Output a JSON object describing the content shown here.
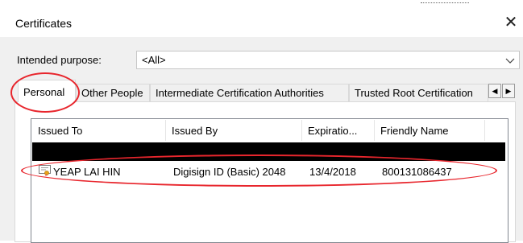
{
  "window": {
    "title": "Certificates",
    "close_glyph": "✕"
  },
  "purpose": {
    "label": "Intended purpose:",
    "value": "<All>",
    "chevron": "chevron-down-icon"
  },
  "tabs": [
    {
      "label": "Personal",
      "active": true
    },
    {
      "label": "Other People",
      "active": false
    },
    {
      "label": "Intermediate Certification Authorities",
      "active": false
    },
    {
      "label": "Trusted Root Certification",
      "active": false
    }
  ],
  "tab_scroll": {
    "left": "◀",
    "right": "▶"
  },
  "columns": [
    "Issued To",
    "Issued By",
    "Expiratio...",
    "Friendly Name"
  ],
  "rows": [
    {
      "redacted": true
    },
    {
      "issued_to": "YEAP LAI HIN",
      "issued_by": "Digisign ID (Basic) 2048",
      "expiration": "13/4/2018",
      "friendly_name": "800131086437",
      "icon": "certificate-icon"
    }
  ],
  "colors": {
    "annotation": "#e8262d",
    "selection": "#000000"
  }
}
